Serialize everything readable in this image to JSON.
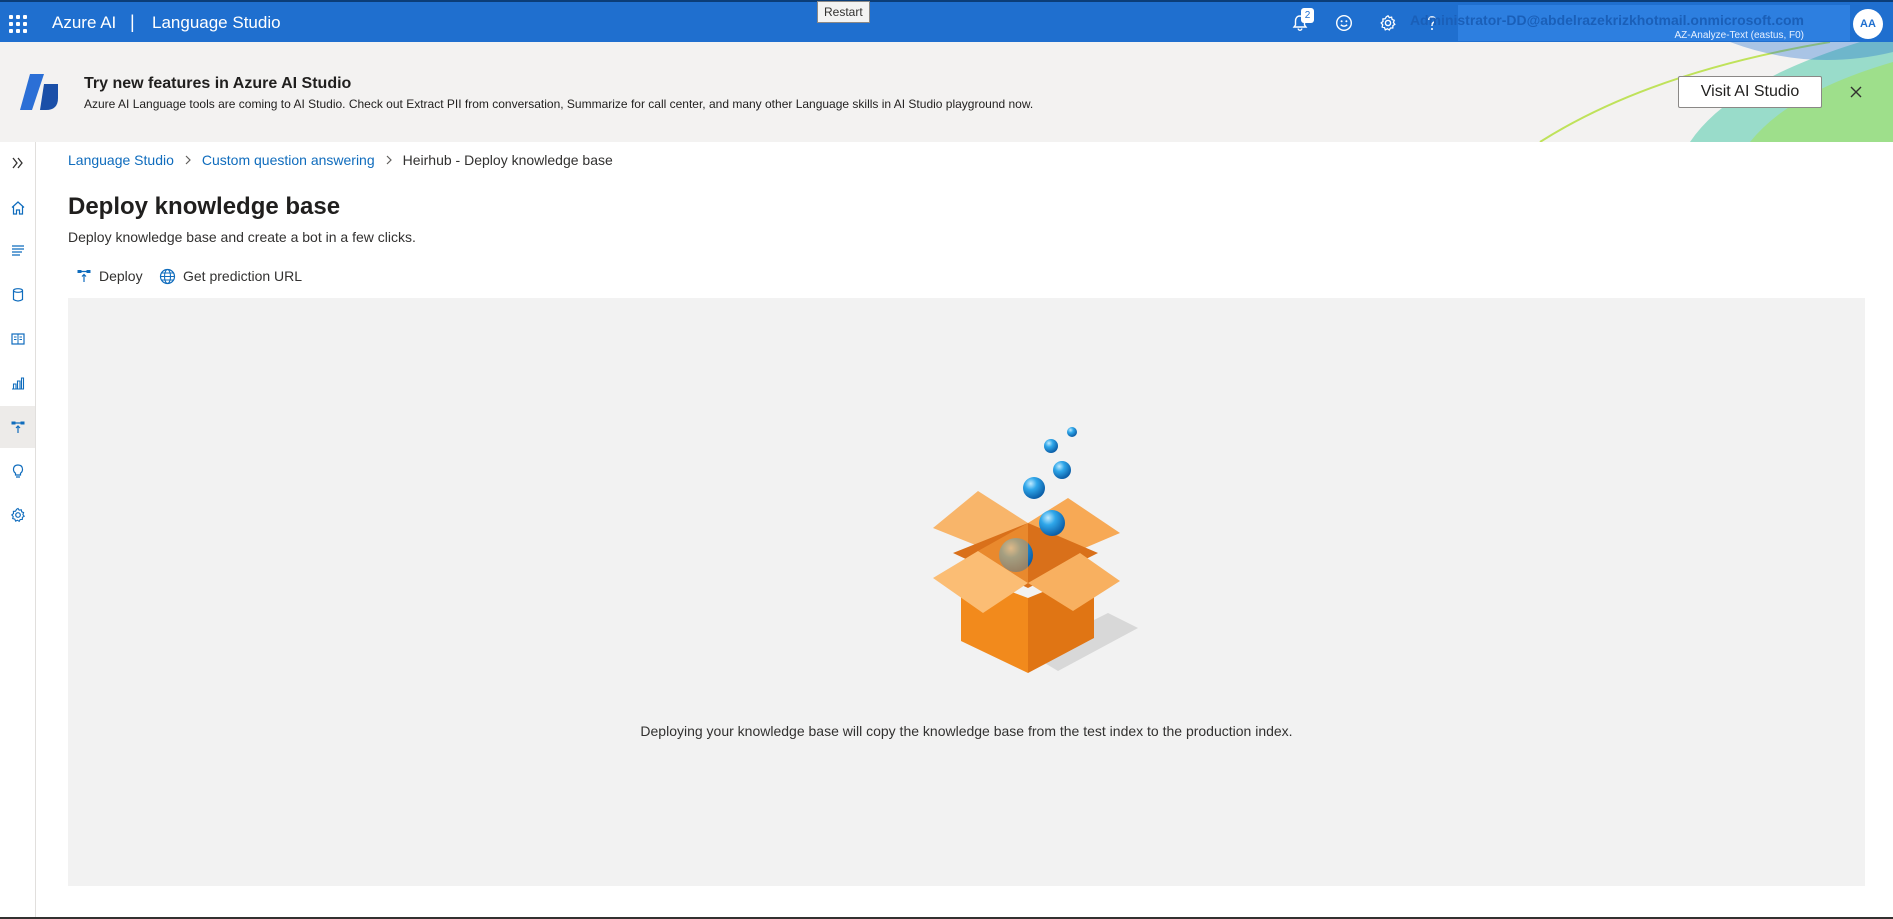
{
  "topbar": {
    "brand": "Azure AI",
    "separator": "|",
    "product": "Language Studio",
    "restart_tooltip": "Restart",
    "notification_count": "2",
    "icons": [
      "waffle-icon",
      "bell-icon",
      "smiley-icon",
      "gear-icon",
      "help-icon"
    ],
    "account_name": "Administrator-DD@abdelrazekrizkhotmail.onmicrosoft.com",
    "account_subtitle": "AZ-Analyze-Text (eastus, F0)",
    "avatar_initials": "AA"
  },
  "banner": {
    "title": "Try new features in Azure AI Studio",
    "text": "Azure AI Language tools are coming to AI Studio. Check out Extract PII from conversation, Summarize for call center, and many other Language skills in AI Studio playground now.",
    "button": "Visit AI Studio"
  },
  "leftnav": {
    "items": [
      "expand-icon",
      "home-icon",
      "text-icon",
      "database-icon",
      "book-icon",
      "chart-icon",
      "deploy-icon",
      "lightbulb-icon",
      "settings-icon"
    ],
    "active": "deploy-icon"
  },
  "breadcrumb": {
    "items": [
      "Language Studio",
      "Custom question answering",
      "Heirhub - Deploy knowledge base"
    ]
  },
  "page": {
    "title": "Deploy knowledge base",
    "subtitle": "Deploy knowledge base and create a bot in a few clicks."
  },
  "commands": {
    "deploy": "Deploy",
    "get_prediction_url": "Get prediction URL"
  },
  "panel": {
    "message": "Deploying your knowledge base will copy the knowledge base from the test index to the production index."
  },
  "colors": {
    "topbar": "#1f6fcf",
    "link": "#0f6cbd",
    "panel": "#f2f2f2",
    "box": "#f5891f"
  }
}
